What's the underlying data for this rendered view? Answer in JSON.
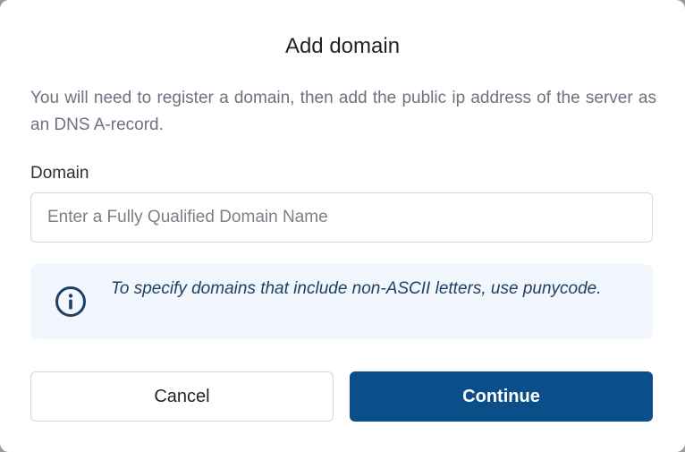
{
  "dialog": {
    "title": "Add domain",
    "description": "You will need to register a domain, then add the public ip address of the server as an DNS A-record.",
    "domain_field": {
      "label": "Domain",
      "value": "",
      "placeholder": "Enter a Fully Qualified Domain Name"
    },
    "info": {
      "icon": "info-circle-icon",
      "text": "To specify domains that include non-ASCII letters, use punycode."
    },
    "buttons": {
      "cancel_label": "Cancel",
      "continue_label": "Continue"
    }
  },
  "colors": {
    "primary": "#0b4f8a",
    "info_background": "#f1f7fd",
    "info_text": "#1e4163",
    "muted_text": "#6b7280"
  }
}
